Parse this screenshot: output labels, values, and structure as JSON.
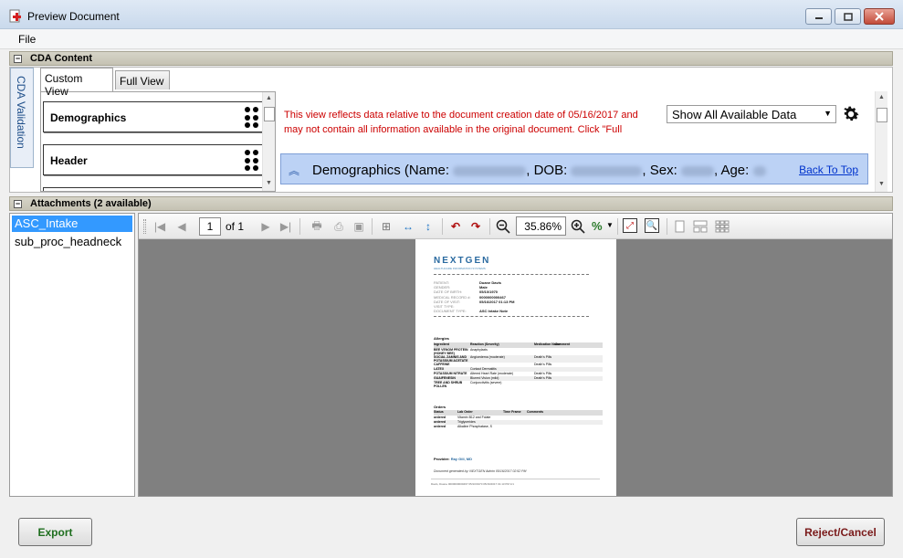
{
  "window": {
    "title": "Preview Document",
    "app_icon": "document-medical-icon",
    "controls": [
      "minimize-icon",
      "maximize-icon",
      "close-icon"
    ]
  },
  "menu": {
    "file": "File"
  },
  "cda": {
    "section_title": "CDA Content",
    "vertical_tab": "CDA Validation",
    "tabs": [
      {
        "label": "Custom View",
        "active": true
      },
      {
        "label": "Full View",
        "active": false
      }
    ],
    "cards": [
      {
        "label": "Demographics"
      },
      {
        "label": "Header"
      }
    ],
    "notice": "This view reflects data relative to the document creation date of 05/16/2017 and may not contain all information available in the original document. Click \"Full",
    "filter_value": "Show All Available Data",
    "demographics_bar": {
      "prefix": "Demographics (Name:",
      "dob_label": ", DOB:",
      "sex_label": ", Sex:",
      "age_label": ", Age:",
      "back_to_top": "Back To Top"
    }
  },
  "attachments": {
    "section_title": "Attachments (2 available)",
    "items": [
      {
        "label": "ASC_Intake",
        "selected": true
      },
      {
        "label": "sub_proc_headneck",
        "selected": false
      }
    ]
  },
  "viewer": {
    "page_current": "1",
    "page_of": "of 1",
    "zoom": "35.86%",
    "zoom_unit_symbol": "%"
  },
  "document": {
    "logo": "NEXTGEN",
    "logo_sub": "HEALTHCARE INFORMATION SYSTEMS",
    "fields": [
      {
        "label": "PATIENT:",
        "value": "Duane Davis"
      },
      {
        "label": "GENDER:",
        "value": "Male"
      },
      {
        "label": "DATE OF BIRTH:",
        "value": "05/10/1970"
      },
      {
        "label": "MEDICAL RECORD #:",
        "value": "0000000000467"
      },
      {
        "label": "DATE OF VISIT:",
        "value": "05/16/2017 01:13 PM"
      },
      {
        "label": "VISIT TYPE:",
        "value": ""
      },
      {
        "label": "DOCUMENT TYPE:",
        "value": "ASC Intake Note"
      }
    ],
    "allergies_title": "Allergies",
    "allergies_headers": [
      "Ingredient",
      "Reaction (Severity)",
      "Medication Name",
      "Comment"
    ],
    "allergies_rows": [
      [
        "BEE VENOM PROTEIN (HONEY BEE)",
        "Anaphylaxis",
        "",
        ""
      ],
      [
        "SOCIAL ZAMNIS AND POTASSIUM ACETATE",
        "Angioedema (moderate)",
        "Death's Pills",
        ""
      ],
      [
        "CAFFEINE",
        "",
        "Death's Pills",
        ""
      ],
      [
        "LATEX",
        "Contact Dermatitis",
        "",
        ""
      ],
      [
        "POTASSIUM NITRATE",
        "Altered Heart Rate (moderate)",
        "Death's Pills",
        ""
      ],
      [
        "GUAIFENESIN",
        "Blurred Vision (mild)",
        "Death's Pills",
        ""
      ],
      [
        "TREE AND SHRUB POLLEN",
        "Conjunctivitis (severe)",
        "",
        ""
      ]
    ],
    "orders_title": "Orders",
    "orders_headers": [
      "Status",
      "Lab Order",
      "Time Frame",
      "Comments"
    ],
    "orders_rows": [
      [
        "ordered",
        "Vitamin B12 and Folate",
        "",
        ""
      ],
      [
        "ordered",
        "Triglycerides",
        "",
        ""
      ],
      [
        "ordered",
        "Alkaline Phosphatase, S",
        "",
        ""
      ]
    ],
    "provider_label": "Provider:",
    "provider_name": "Ray Gill, MD",
    "generated": "Document generated by: NEXTGEN Admin 05/16/2017 02:52 PM",
    "footer": "Davis, Duane   0000000000467 05/10/1970 05/16/2017 01:13 PM   1/1"
  },
  "buttons": {
    "export": "Export",
    "reject": "Reject/Cancel"
  },
  "colors": {
    "notice_red": "#cc0000",
    "export_text": "#1e6e1e",
    "reject_text": "#7a1a1a",
    "selected_blue": "#3399ff",
    "demographics_bar": "#bcd2f5"
  }
}
